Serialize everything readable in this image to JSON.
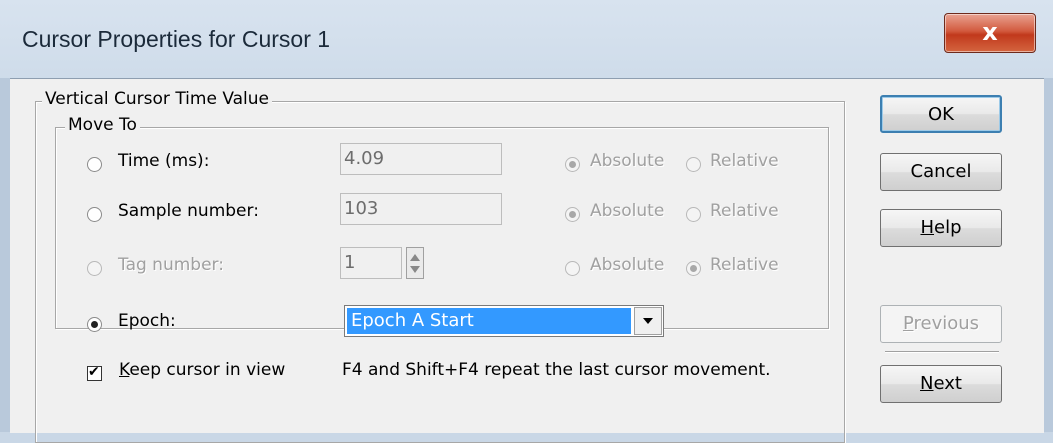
{
  "window": {
    "title": "Cursor Properties for Cursor 1",
    "close_glyph": "x",
    "close_icon": "close-icon"
  },
  "group_vertical": {
    "legend": "Vertical Cursor Time Value"
  },
  "group_move": {
    "legend": "Move To"
  },
  "rows": {
    "time": {
      "label": "Time (ms):",
      "value": "4.09",
      "absolute": "Absolute",
      "relative": "Relative",
      "mode": "Absolute"
    },
    "sample": {
      "label": "Sample number:",
      "value": "103",
      "absolute": "Absolute",
      "relative": "Relative",
      "mode": "Absolute"
    },
    "tag": {
      "label": "Tag number:",
      "value": "1",
      "absolute": "Absolute",
      "relative": "Relative",
      "mode": "Relative"
    },
    "epoch": {
      "label": "Epoch:",
      "selected": "Epoch A Start"
    }
  },
  "move_to_selected": "Epoch",
  "keep_in_view": {
    "label": "Keep cursor in view",
    "checked": true
  },
  "hint": "F4 and Shift+F4 repeat the last cursor movement.",
  "buttons": {
    "ok": "OK",
    "cancel": "Cancel",
    "help": "Help",
    "previous": "Previous",
    "next": "Next"
  },
  "colors": {
    "selection": "#3399ff",
    "dialog_bg": "#f0f0f0",
    "close": "#c7432a"
  }
}
